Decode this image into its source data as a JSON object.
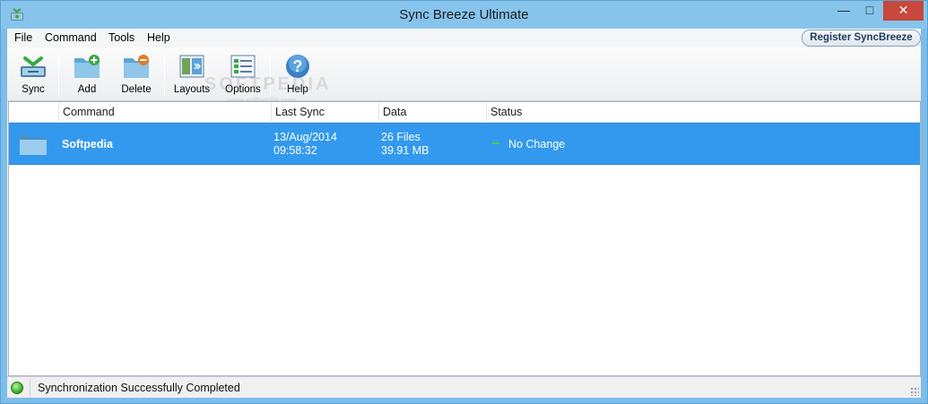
{
  "window": {
    "title": "Sync Breeze Ultimate",
    "minimize_glyph": "—",
    "maximize_glyph": "□",
    "close_glyph": "✕"
  },
  "menu": {
    "items": [
      "File",
      "Command",
      "Tools",
      "Help"
    ],
    "register_label": "Register SyncBreeze"
  },
  "toolbar": {
    "buttons": [
      {
        "label": "Sync",
        "icon": "sync-icon"
      },
      {
        "label": "Add",
        "icon": "folder-add-icon"
      },
      {
        "label": "Delete",
        "icon": "folder-delete-icon"
      },
      {
        "label": "Layouts",
        "icon": "layouts-icon"
      },
      {
        "label": "Options",
        "icon": "options-icon"
      },
      {
        "label": "Help",
        "icon": "help-icon"
      }
    ]
  },
  "watermark": {
    "text": "SOFTPEDIA",
    "sub": "www.softpedia.com"
  },
  "list": {
    "columns": [
      "Command",
      "Last Sync",
      "Data",
      "Status"
    ],
    "rows": [
      {
        "name": "Softpedia",
        "last_sync_date": "13/Aug/2014",
        "last_sync_time": "09:58:32",
        "files": "26 Files",
        "size": "39.91 MB",
        "status": "No Change",
        "selected": true
      }
    ]
  },
  "statusbar": {
    "text": "Synchronization Successfully Completed"
  },
  "colors": {
    "accent": "#3399ee",
    "titlebar": "#86c4ec",
    "close": "#c7483c",
    "status_ok": "#3eb02b"
  }
}
